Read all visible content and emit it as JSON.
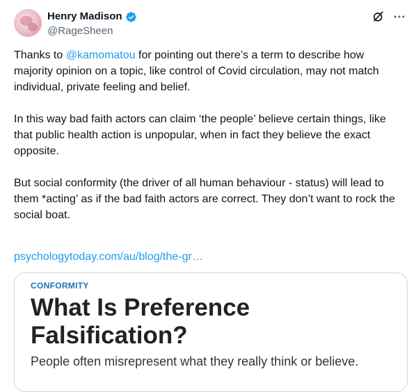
{
  "author": {
    "name": "Henry Madison",
    "handle": "@RageSheen",
    "verified_color": "#1d9bf0"
  },
  "icons": {
    "grok": "grok-icon",
    "more": "more-icon",
    "verified": "verified-badge-icon"
  },
  "tweet": {
    "p1_prefix": "Thanks to ",
    "p1_mention": "@kamomatou",
    "p1_suffix": " for pointing out there’s a term to describe how majority opinion on a topic, like control of Covid circulation, may not match individual, private feeling and belief.",
    "p2": "In this way bad faith actors can claim ‘the people’ believe certain things, like that public health action is unpopular, when in fact they believe the exact opposite.",
    "p3": "But social conformity (the driver of all human behaviour - status) will lead to them *acting’ as if the bad faith actors are correct. They don’t want to rock the social boat.",
    "link": "psychologytoday.com/au/blog/the-gr…"
  },
  "card": {
    "kicker": "CONFORMITY",
    "title": "What Is Preference Falsification?",
    "subtitle": "People often misrepresent what they really think or believe."
  },
  "colors": {
    "accent": "#1d9bf0",
    "text": "#0f1419",
    "muted": "#536471",
    "card_kicker": "#1d6fb8"
  }
}
